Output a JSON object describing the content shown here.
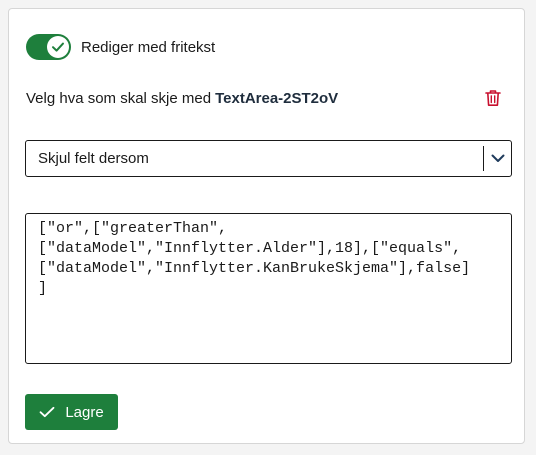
{
  "toggle": {
    "label": "Rediger med fritekst",
    "on": true
  },
  "heading": {
    "text": "Velg hva som skal skje med",
    "component": "TextArea-2ST2oV"
  },
  "select": {
    "value": "Skjul felt dersom"
  },
  "expression": {
    "lines": [
      "[\"or\",[\"greaterThan\",",
      "[\"dataModel\",\"Innflytter.Alder\"],18],[\"equals\",",
      "[\"dataModel\",\"Innflytter.KanBrukeSkjema\"],false]",
      "]"
    ]
  },
  "save": {
    "label": "Lagre"
  },
  "colors": {
    "accent": "#1e7f3c",
    "danger": "#c8102e"
  },
  "icons": {
    "toggle_check": "check-icon",
    "delete": "trash-icon",
    "dropdown": "chevron-down-icon",
    "save": "check-icon"
  }
}
